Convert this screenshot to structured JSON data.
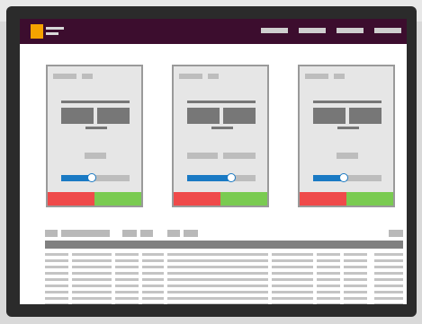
{
  "colors": {
    "frame": "#2b2b2b",
    "app_bar": "#3c0d2e",
    "logo": "#f5a300",
    "slider_fill": "#1a7ac4",
    "decline": "#ef4a4a",
    "accept": "#7acb51"
  },
  "header": {
    "logo_icon": "app-logo-icon",
    "menu_icon": "hamburger-menu-icon",
    "nav_items": [
      "",
      "",
      "",
      ""
    ]
  },
  "cards": [
    {
      "slider_level": 0.45
    },
    {
      "slider_level": 0.65
    },
    {
      "slider_level": 0.45
    }
  ],
  "table": {
    "row_count": 11,
    "column_count": 8
  }
}
